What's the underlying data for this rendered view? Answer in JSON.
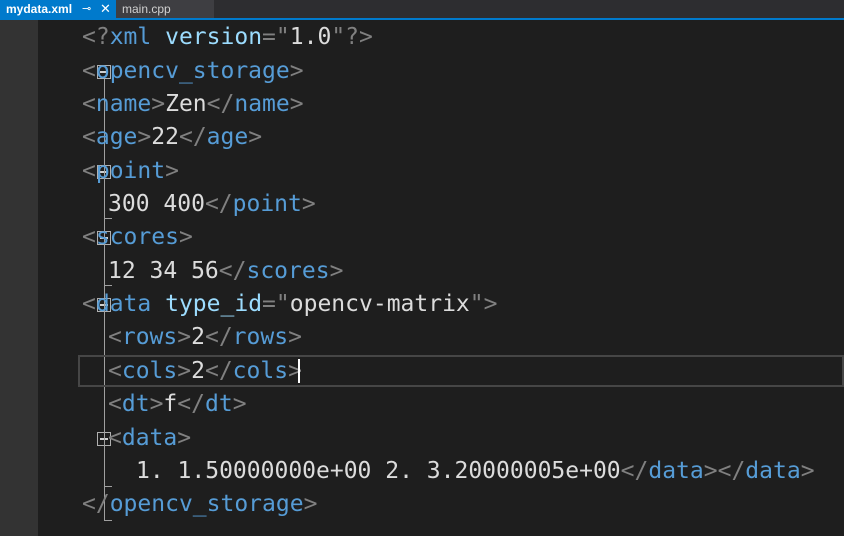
{
  "tabs": [
    {
      "label": "mydata.xml",
      "active": true
    },
    {
      "label": "main.cpp",
      "active": false
    }
  ],
  "tab_icons": {
    "pin": "⊸",
    "close": "✕"
  },
  "colors": {
    "active_tab": "#007acc",
    "editor_bg": "#1e1e1e",
    "tag": "#569cd6",
    "attribute": "#9cdcfe",
    "punctuation": "#808080",
    "text": "#dcdcdc"
  },
  "code": {
    "l1": {
      "open": "<?",
      "name": "xml",
      "attr": "version",
      "eq": "=",
      "quote1": "\"",
      "value": "1.0",
      "quote2": "\"",
      "close": "?>"
    },
    "l2": {
      "lt": "<",
      "tag": "opencv_storage",
      "gt": ">"
    },
    "l3": {
      "lt": "<",
      "tag": "name",
      "gt": ">",
      "text": "Zen",
      "lt2": "</",
      "tag2": "name",
      "gt2": ">"
    },
    "l4": {
      "lt": "<",
      "tag": "age",
      "gt": ">",
      "text": "22",
      "lt2": "</",
      "tag2": "age",
      "gt2": ">"
    },
    "l5": {
      "lt": "<",
      "tag": "point",
      "gt": ">"
    },
    "l6": {
      "text": "300 400",
      "lt2": "</",
      "tag2": "point",
      "gt2": ">"
    },
    "l7": {
      "lt": "<",
      "tag": "scores",
      "gt": ">"
    },
    "l8": {
      "text": "12 34 56",
      "lt2": "</",
      "tag2": "scores",
      "gt2": ">"
    },
    "l9": {
      "lt": "<",
      "tag": "data",
      "attr": "type_id",
      "eq": "=",
      "quote1": "\"",
      "value": "opencv-matrix",
      "quote2": "\"",
      "gt": ">"
    },
    "l10": {
      "lt": "<",
      "tag": "rows",
      "gt": ">",
      "text": "2",
      "lt2": "</",
      "tag2": "rows",
      "gt2": ">"
    },
    "l11": {
      "lt": "<",
      "tag": "cols",
      "gt": ">",
      "text": "2",
      "lt2": "</",
      "tag2": "cols",
      "gt2": ">"
    },
    "l12": {
      "lt": "<",
      "tag": "dt",
      "gt": ">",
      "text": "f",
      "lt2": "</",
      "tag2": "dt",
      "gt2": ">"
    },
    "l13": {
      "lt": "<",
      "tag": "data",
      "gt": ">"
    },
    "l14": {
      "text": "1. 1.50000000e+00 2. 3.20000005e+00",
      "lt2": "</",
      "tag2": "data",
      "gt2": "></",
      "tag3": "data",
      "gt3": ">"
    },
    "l15": {
      "lt2": "</",
      "tag2": "opencv_storage",
      "gt2": ">"
    }
  }
}
